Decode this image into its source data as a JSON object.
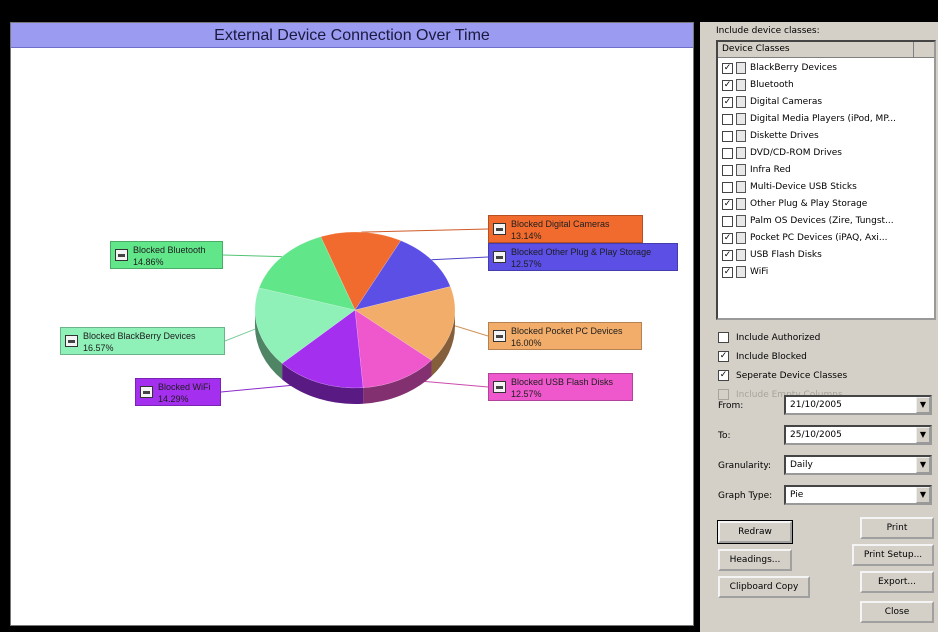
{
  "chart": {
    "title": "External Device Connection Over Time"
  },
  "chart_data": {
    "type": "pie",
    "title": "External Device Connection Over Time",
    "slices": [
      {
        "name": "Blocked Digital Cameras",
        "pct_label": "13.14%",
        "value": 13.14,
        "color": "#f26b2e"
      },
      {
        "name": "Blocked Other Plug & Play Storage",
        "pct_label": "12.57%",
        "value": 12.57,
        "color": "#5b4fe6"
      },
      {
        "name": "Blocked Pocket PC Devices",
        "pct_label": "16.00%",
        "value": 16.0,
        "color": "#f2ad6b"
      },
      {
        "name": "Blocked USB Flash Disks",
        "pct_label": "12.57%",
        "value": 12.57,
        "color": "#ee58cc"
      },
      {
        "name": "Blocked WiFi",
        "pct_label": "14.29%",
        "value": 14.29,
        "color": "#a42fee"
      },
      {
        "name": "Blocked BlackBerry Devices",
        "pct_label": "16.57%",
        "value": 16.57,
        "color": "#8ff0b8"
      },
      {
        "name": "Blocked Bluetooth",
        "pct_label": "14.86%",
        "value": 14.86,
        "color": "#62e68a"
      }
    ]
  },
  "side_panel": {
    "include_device_classes_label": "Include device classes:",
    "list_header": "Device Classes",
    "device_classes": [
      {
        "label": "BlackBerry Devices",
        "checked": true
      },
      {
        "label": "Bluetooth",
        "checked": true
      },
      {
        "label": "Digital Cameras",
        "checked": true
      },
      {
        "label": "Digital Media Players (iPod, MP...",
        "checked": false
      },
      {
        "label": "Diskette Drives",
        "checked": false
      },
      {
        "label": "DVD/CD-ROM Drives",
        "checked": false
      },
      {
        "label": "Infra Red",
        "checked": false
      },
      {
        "label": "Multi-Device USB Sticks",
        "checked": false
      },
      {
        "label": "Other Plug & Play Storage",
        "checked": true
      },
      {
        "label": "Palm OS Devices (Zire, Tungst...",
        "checked": false
      },
      {
        "label": "Pocket PC Devices (iPAQ, Axi...",
        "checked": true
      },
      {
        "label": "USB Flash Disks",
        "checked": true
      },
      {
        "label": "WiFi",
        "checked": true
      }
    ],
    "options": {
      "include_authorized": {
        "label": "Include Authorized",
        "checked": false
      },
      "include_blocked": {
        "label": "Include Blocked",
        "checked": true
      },
      "separate_device_classes": {
        "label": "Seperate Device Classes",
        "checked": true
      },
      "include_empty_columns": {
        "label": "Include Empty Columns",
        "checked": false,
        "disabled": true
      }
    },
    "from": {
      "label": "From:",
      "value": "21/10/2005"
    },
    "to": {
      "label": "To:",
      "value": "25/10/2005"
    },
    "granularity": {
      "label": "Granularity:",
      "value": "Daily"
    },
    "graph_type": {
      "label": "Graph Type:",
      "value": "Pie"
    },
    "buttons": {
      "redraw": "Redraw",
      "print": "Print",
      "headings": "Headings...",
      "print_setup": "Print Setup...",
      "clipboard_copy": "Clipboard Copy",
      "export": "Export...",
      "close": "Close"
    }
  }
}
